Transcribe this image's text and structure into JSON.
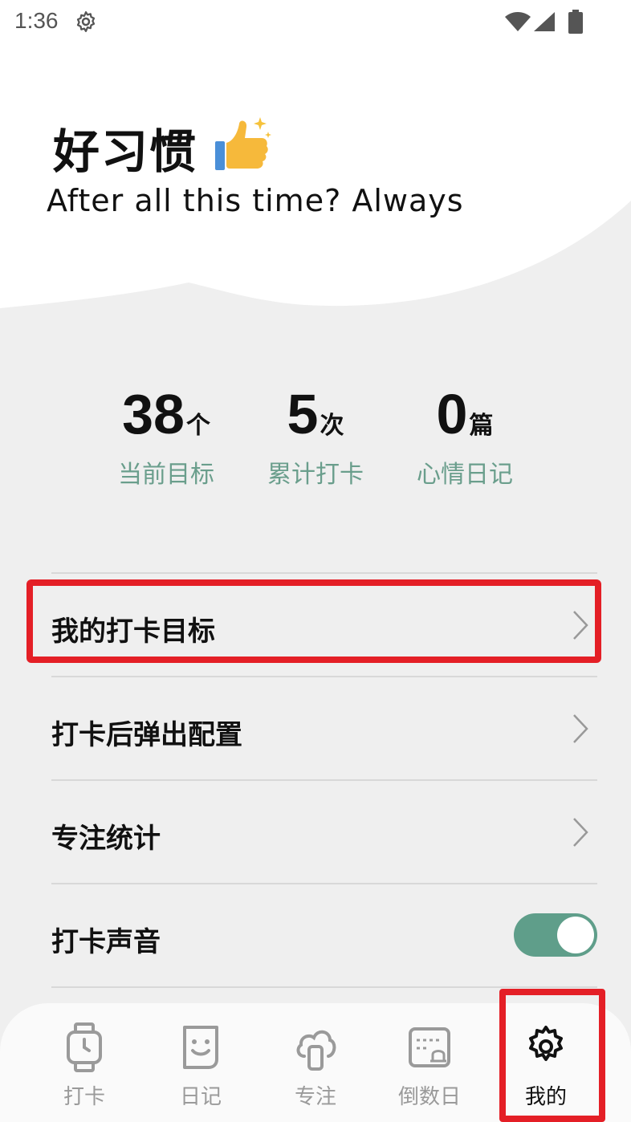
{
  "status_bar": {
    "time": "1:36",
    "icons": [
      "settings-gear-icon",
      "wifi-icon",
      "cellular-signal-icon",
      "battery-icon"
    ]
  },
  "header": {
    "title": "好习惯",
    "title_icon": "thumbs-up-sparkle-icon",
    "subtitle": "After all this time? Always"
  },
  "stats": [
    {
      "value": "38",
      "unit": "个",
      "label": "当前目标"
    },
    {
      "value": "5",
      "unit": "次",
      "label": "累计打卡"
    },
    {
      "value": "0",
      "unit": "篇",
      "label": "心情日记"
    }
  ],
  "menu": {
    "items": [
      {
        "label": "我的打卡目标",
        "control": "chevron"
      },
      {
        "label": "打卡后弹出配置",
        "control": "chevron"
      },
      {
        "label": "专注统计",
        "control": "chevron"
      },
      {
        "label": "打卡声音",
        "control": "toggle",
        "toggle_on": true
      }
    ]
  },
  "tab_bar": {
    "tabs": [
      {
        "label": "打卡",
        "icon": "watch-clock-icon"
      },
      {
        "label": "日记",
        "icon": "smiley-note-icon"
      },
      {
        "label": "专注",
        "icon": "cloud-phone-icon"
      },
      {
        "label": "倒数日",
        "icon": "calendar-bell-icon"
      },
      {
        "label": "我的",
        "icon": "settings-gear-icon",
        "active": true
      }
    ]
  },
  "colors": {
    "accent_green": "#6a9e8c",
    "toggle_green": "#5f9e8a",
    "highlight_red": "#e41f26",
    "background": "#efefef"
  }
}
